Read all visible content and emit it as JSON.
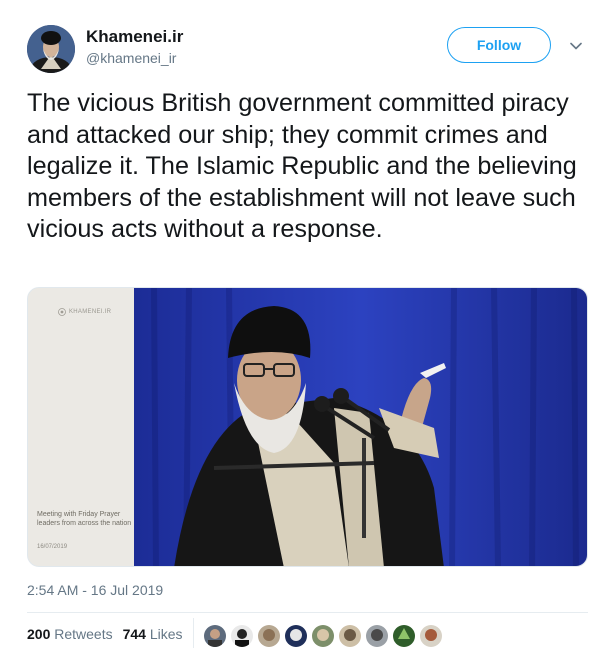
{
  "author": {
    "name": "Khamenei.ir",
    "handle": "@khamenei_ir"
  },
  "follow_label": "Follow",
  "tweet_text": "The vicious British government committed piracy and attacked our ship; they commit crimes and legalize it. The Islamic Republic and the believing members of the establishment will not leave such vicious acts without a response.",
  "media": {
    "logo_text": "KHAMENEI.IR",
    "caption": "Meeting with Friday Prayer leaders from across the nation",
    "date": "16/07/2019"
  },
  "timestamp": "2:54 AM - 16 Jul 2019",
  "stats": {
    "retweets_count": "200",
    "retweets_label": "Retweets",
    "likes_count": "744",
    "likes_label": "Likes"
  },
  "colors": {
    "accent": "#1da1f2",
    "secondary_text": "#657786",
    "curtain": "#2a3fb8"
  },
  "icons": [
    "chevron-down-icon",
    "avatar",
    "liker-avatars"
  ]
}
